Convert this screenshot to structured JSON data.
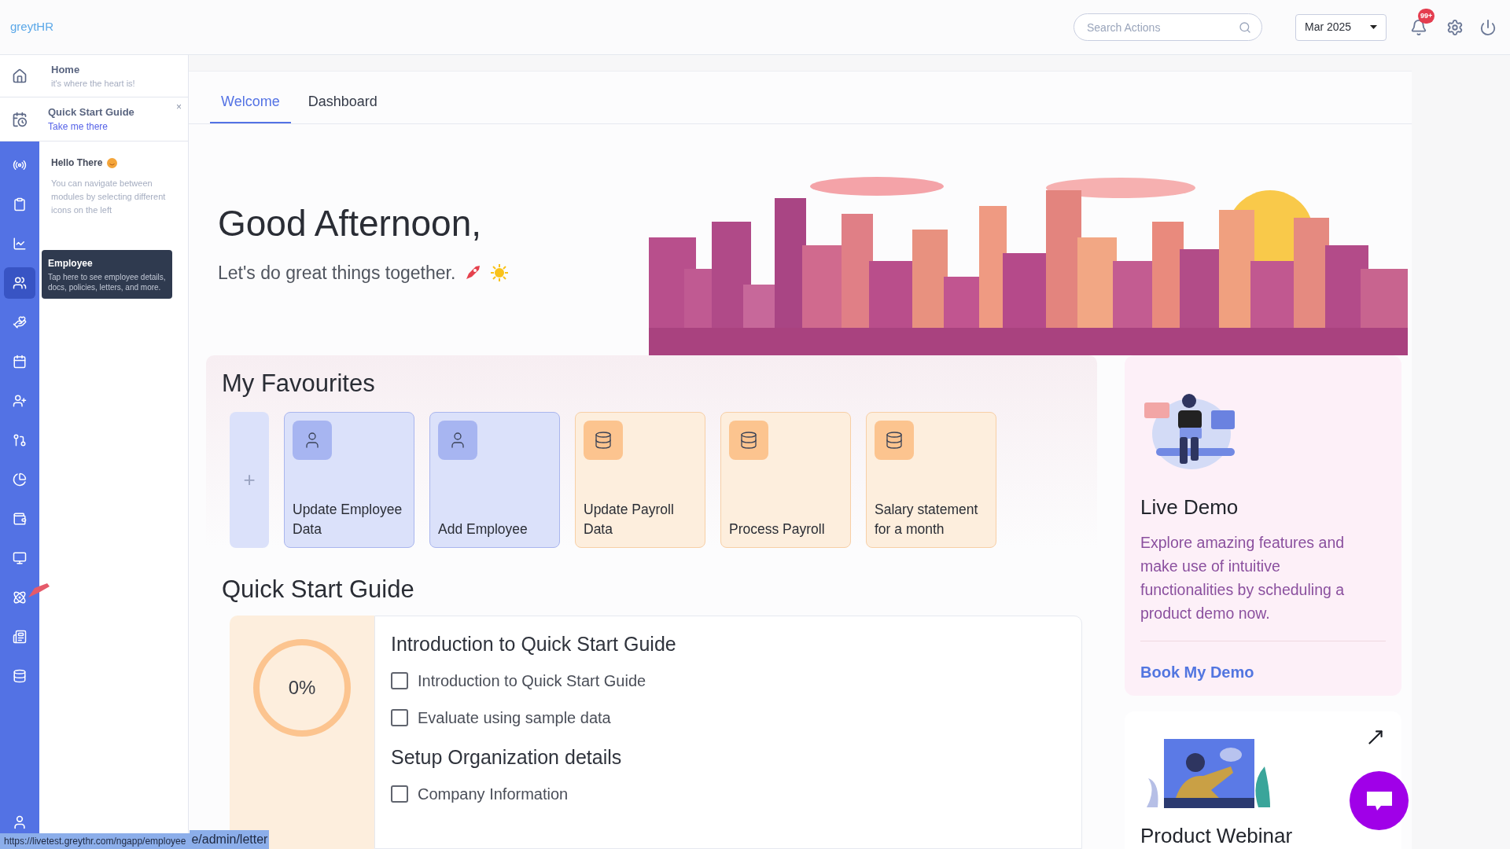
{
  "logo": "greytHR",
  "search": {
    "placeholder": "Search Actions"
  },
  "month_select": {
    "value": "Mar 2025"
  },
  "notifications": {
    "badge": "99+"
  },
  "nav_panel": {
    "home": {
      "title": "Home",
      "subtitle": "it's where the heart is!"
    },
    "quick_start": {
      "title": "Quick Start Guide",
      "link": "Take me there",
      "close": "×"
    },
    "hello": {
      "title": "Hello There",
      "text": "You can navigate between modules by selecting different icons on the left"
    }
  },
  "rail": [
    {
      "kind": "broadcast",
      "selected": false
    },
    {
      "kind": "clipboard",
      "selected": false
    },
    {
      "kind": "chart",
      "selected": false
    },
    {
      "kind": "users",
      "selected": true
    },
    {
      "kind": "hand",
      "selected": false
    },
    {
      "kind": "calendar",
      "selected": false
    },
    {
      "kind": "user-plus",
      "selected": false
    },
    {
      "kind": "flow",
      "selected": false
    },
    {
      "kind": "pie",
      "selected": false
    },
    {
      "kind": "wallet",
      "selected": false
    },
    {
      "kind": "monitor",
      "selected": false
    },
    {
      "kind": "atom",
      "selected": false
    },
    {
      "kind": "news",
      "selected": false
    },
    {
      "kind": "database",
      "selected": false
    }
  ],
  "tooltip": {
    "title": "Employee",
    "text": "Tap here to see employee details, docs, policies, letters, and more."
  },
  "tabs": [
    {
      "label": "Welcome",
      "selected": true
    },
    {
      "label": "Dashboard",
      "selected": false
    }
  ],
  "greeting": {
    "title": "Good Afternoon,",
    "subtitle": "Let's do great things together."
  },
  "favourites": {
    "title": "My Favourites",
    "add": "+",
    "items": [
      {
        "label": "Update Employee Data",
        "kind": "employee"
      },
      {
        "label": "Add Employee",
        "kind": "employee"
      },
      {
        "label": "Update Payroll Data",
        "kind": "payroll"
      },
      {
        "label": "Process Payroll",
        "kind": "payroll"
      },
      {
        "label": "Salary statement for a month",
        "kind": "payroll"
      }
    ]
  },
  "quick_start": {
    "title": "Quick Start Guide",
    "progress": "0%",
    "level": 0,
    "sections": [
      {
        "title": "Introduction to Quick Start Guide",
        "items": [
          {
            "label": "Introduction to Quick Start Guide",
            "checked": false
          },
          {
            "label": "Evaluate using sample data",
            "checked": false
          }
        ]
      },
      {
        "title": "Setup Organization details",
        "items": [
          {
            "label": "Company Information",
            "checked": false
          }
        ]
      }
    ]
  },
  "live_demo": {
    "title": "Live Demo",
    "text": "Explore amazing features and make use of intuitive functionalities by scheduling a product demo now.",
    "link": "Book My Demo"
  },
  "webinar": {
    "title": "Product Webinar"
  },
  "status_url": {
    "base": "https://livetest.greythr.com/ngapp/employee",
    "rest": "e/admin/letter"
  }
}
